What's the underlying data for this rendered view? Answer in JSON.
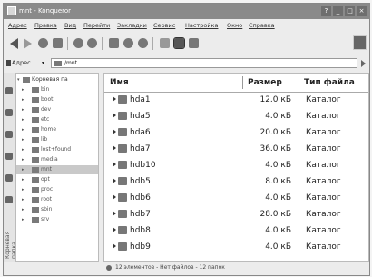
{
  "window": {
    "title": "mnt - Konqueror",
    "controls": [
      "?",
      "_",
      "□",
      "×"
    ]
  },
  "menu": [
    "Адрес",
    "Правка",
    "Вид",
    "Перейти",
    "Закладки",
    "Сервис",
    "Настройка",
    "Окно",
    "Справка"
  ],
  "toolbar": {
    "icons": [
      "back-arrow-icon",
      "forward-arrow-icon",
      "up-arrow-icon",
      "home-icon",
      "reload-icon",
      "stop-icon",
      "delete-icon",
      "zoom-in-icon",
      "zoom-out-icon",
      "view-mode-icon",
      "view-details-icon",
      "settings-icon",
      "konqueror-logo-icon"
    ]
  },
  "address": {
    "label": "Адрес",
    "value": "/mnt"
  },
  "tree": {
    "root": "Корневая па",
    "items": [
      "bin",
      "boot",
      "dev",
      "etc",
      "home",
      "lib",
      "lost+found",
      "media",
      "mnt",
      "opt",
      "proc",
      "root",
      "sbin",
      "srv"
    ],
    "selected": "mnt",
    "side_tab_label": "Корневая папка"
  },
  "columns": {
    "name": "Имя",
    "size": "Размер",
    "type": "Тип файла"
  },
  "files": [
    {
      "name": "hda1",
      "size": "12.0 кБ",
      "type": "Каталог"
    },
    {
      "name": "hda5",
      "size": "4.0 кБ",
      "type": "Каталог"
    },
    {
      "name": "hda6",
      "size": "20.0 кБ",
      "type": "Каталог"
    },
    {
      "name": "hda7",
      "size": "36.0 кБ",
      "type": "Каталог"
    },
    {
      "name": "hdb10",
      "size": "4.0 кБ",
      "type": "Каталог"
    },
    {
      "name": "hdb5",
      "size": "8.0 кБ",
      "type": "Каталог"
    },
    {
      "name": "hdb6",
      "size": "4.0 кБ",
      "type": "Каталог"
    },
    {
      "name": "hdb7",
      "size": "28.0 кБ",
      "type": "Каталог"
    },
    {
      "name": "hdb8",
      "size": "4.0 кБ",
      "type": "Каталог"
    },
    {
      "name": "hdb9",
      "size": "4.0 кБ",
      "type": "Каталог"
    }
  ],
  "status": "12 элементов - Нет файлов - 12 папок"
}
